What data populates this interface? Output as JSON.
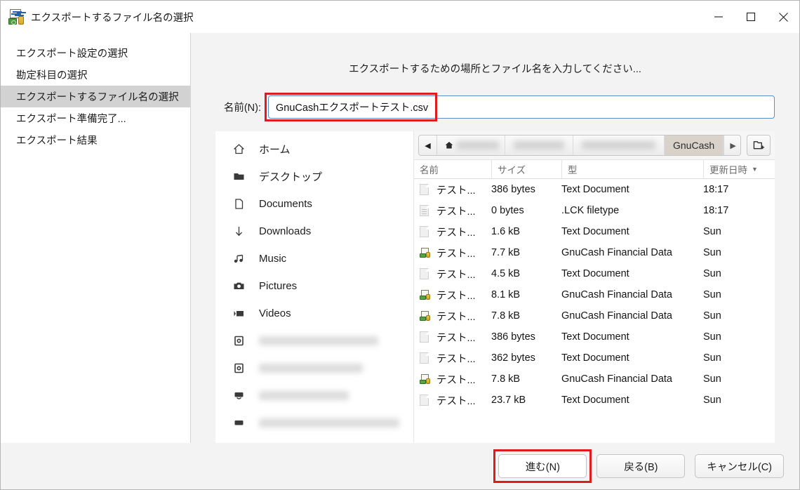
{
  "window": {
    "title": "エクスポートするファイル名の選択",
    "app_icon": "gnucash-icon",
    "minimize_label": "—",
    "maximize_label": "□",
    "close_label": "✕"
  },
  "wizard_nav": {
    "items": [
      {
        "label": "エクスポート設定の選択",
        "selected": false
      },
      {
        "label": "勘定科目の選択",
        "selected": false
      },
      {
        "label": "エクスポートするファイル名の選択",
        "selected": true
      },
      {
        "label": "エクスポート準備完了...",
        "selected": false
      },
      {
        "label": "エクスポート結果",
        "selected": false
      }
    ]
  },
  "panel": {
    "heading": "エクスポートするための場所とファイル名を入力してください...",
    "name_label": "名前(N):",
    "name_value": "GnuCashエクスポートテスト.csv",
    "name_placeholder": ""
  },
  "places": {
    "items": [
      {
        "label": "ホーム",
        "icon": "home-icon",
        "blurred": false
      },
      {
        "label": "デスクトップ",
        "icon": "folder-icon",
        "blurred": false
      },
      {
        "label": "Documents",
        "icon": "document-icon",
        "blurred": false
      },
      {
        "label": "Downloads",
        "icon": "download-arrow-icon",
        "blurred": false
      },
      {
        "label": "Music",
        "icon": "music-note-icon",
        "blurred": false
      },
      {
        "label": "Pictures",
        "icon": "camera-icon",
        "blurred": false
      },
      {
        "label": "Videos",
        "icon": "video-icon",
        "blurred": false
      },
      {
        "label": "",
        "icon": "drive-icon",
        "blurred": true
      },
      {
        "label": "",
        "icon": "drive-icon",
        "blurred": true
      },
      {
        "label": "",
        "icon": "network-drive-icon",
        "blurred": true
      },
      {
        "label": "",
        "icon": "network-drive-icon",
        "blurred": true
      }
    ]
  },
  "pathbar": {
    "back_arrow": "◀",
    "forward_arrow": "▶",
    "new_folder_icon": "new-folder-icon",
    "crumbs": [
      {
        "label": "",
        "icon": "home-icon",
        "blurred": true,
        "active": false
      },
      {
        "label": "",
        "blurred": true,
        "active": false
      },
      {
        "label": "",
        "blurred": true,
        "active": false
      },
      {
        "label": "GnuCash",
        "blurred": false,
        "active": true
      }
    ]
  },
  "file_list": {
    "columns": {
      "name": "名前",
      "size": "サイズ",
      "type": "型",
      "modified": "更新日時",
      "sort_caret": "▼"
    },
    "rows": [
      {
        "icon": "text-document-icon",
        "name": "テスト...",
        "size": "386 bytes",
        "type": "Text Document",
        "modified": "18:17"
      },
      {
        "icon": "lck-document-icon",
        "name": "テスト...",
        "size": "0 bytes",
        "type": ".LCK filetype",
        "modified": "18:17"
      },
      {
        "icon": "text-document-icon",
        "name": "テスト...",
        "size": "1.6 kB",
        "type": "Text Document",
        "modified": "Sun"
      },
      {
        "icon": "gnucash-file-icon",
        "name": "テスト...",
        "size": "7.7 kB",
        "type": "GnuCash Financial Data",
        "modified": "Sun"
      },
      {
        "icon": "text-document-icon",
        "name": "テスト...",
        "size": "4.5 kB",
        "type": "Text Document",
        "modified": "Sun"
      },
      {
        "icon": "gnucash-file-icon",
        "name": "テスト...",
        "size": "8.1 kB",
        "type": "GnuCash Financial Data",
        "modified": "Sun"
      },
      {
        "icon": "gnucash-file-icon",
        "name": "テスト...",
        "size": "7.8 kB",
        "type": "GnuCash Financial Data",
        "modified": "Sun"
      },
      {
        "icon": "text-document-icon",
        "name": "テスト...",
        "size": "386 bytes",
        "type": "Text Document",
        "modified": "Sun"
      },
      {
        "icon": "text-document-icon",
        "name": "テスト...",
        "size": "362 bytes",
        "type": "Text Document",
        "modified": "Sun"
      },
      {
        "icon": "gnucash-file-icon",
        "name": "テスト...",
        "size": "7.8 kB",
        "type": "GnuCash Financial Data",
        "modified": "Sun"
      },
      {
        "icon": "text-document-icon",
        "name": "テスト...",
        "size": "23.7 kB",
        "type": "Text Document",
        "modified": "Sun"
      }
    ]
  },
  "footer": {
    "next_label": "進む(N)",
    "back_label": "戻る(B)",
    "cancel_label": "キャンセル(C)"
  },
  "colors": {
    "annotation_red": "#e01b1b",
    "focus_blue": "#5b8fc9",
    "selection_grey": "#d2d2d2",
    "crumb_active": "#d8d2ca"
  }
}
